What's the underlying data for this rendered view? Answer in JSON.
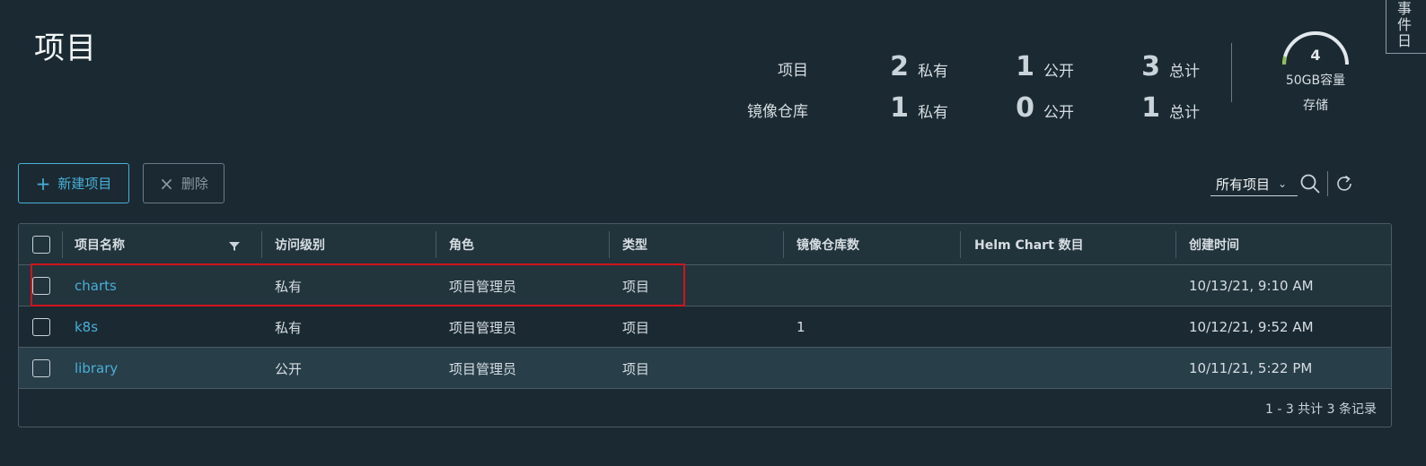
{
  "page": {
    "title": "项目"
  },
  "side_tab": {
    "label": "事件日"
  },
  "summary": {
    "rows": [
      {
        "label": "项目",
        "items": [
          {
            "num": "2",
            "unit": "私有"
          },
          {
            "num": "1",
            "unit": "公开"
          },
          {
            "num": "3",
            "unit": "总计"
          }
        ]
      },
      {
        "label": "镜像仓库",
        "items": [
          {
            "num": "1",
            "unit": "私有"
          },
          {
            "num": "0",
            "unit": "公开"
          },
          {
            "num": "1",
            "unit": "总计"
          }
        ]
      }
    ],
    "storage": {
      "value": "4",
      "capacity": "50GB容量",
      "label": "存储",
      "used_fraction": 0.08
    }
  },
  "toolbar": {
    "new_project": "新建项目",
    "delete": "删除",
    "filter_value": "所有项目"
  },
  "table": {
    "columns": [
      "项目名称",
      "访问级别",
      "角色",
      "类型",
      "镜像仓库数",
      "Helm Chart 数目",
      "创建时间"
    ],
    "rows": [
      {
        "name": "charts",
        "access": "私有",
        "role": "项目管理员",
        "type": "项目",
        "repos": "",
        "charts": "",
        "created": "10/13/21, 9:10 AM"
      },
      {
        "name": "k8s",
        "access": "私有",
        "role": "项目管理员",
        "type": "项目",
        "repos": "1",
        "charts": "",
        "created": "10/12/21, 9:52 AM"
      },
      {
        "name": "library",
        "access": "公开",
        "role": "项目管理员",
        "type": "项目",
        "repos": "",
        "charts": "",
        "created": "10/11/21, 5:22 PM"
      }
    ],
    "footer": "1 - 3 共计 3 条记录"
  },
  "colors": {
    "background": "#1b2a32",
    "accent": "#49afd9",
    "gauge_fill": "#8fbf5a",
    "highlight": "#d0141c"
  }
}
